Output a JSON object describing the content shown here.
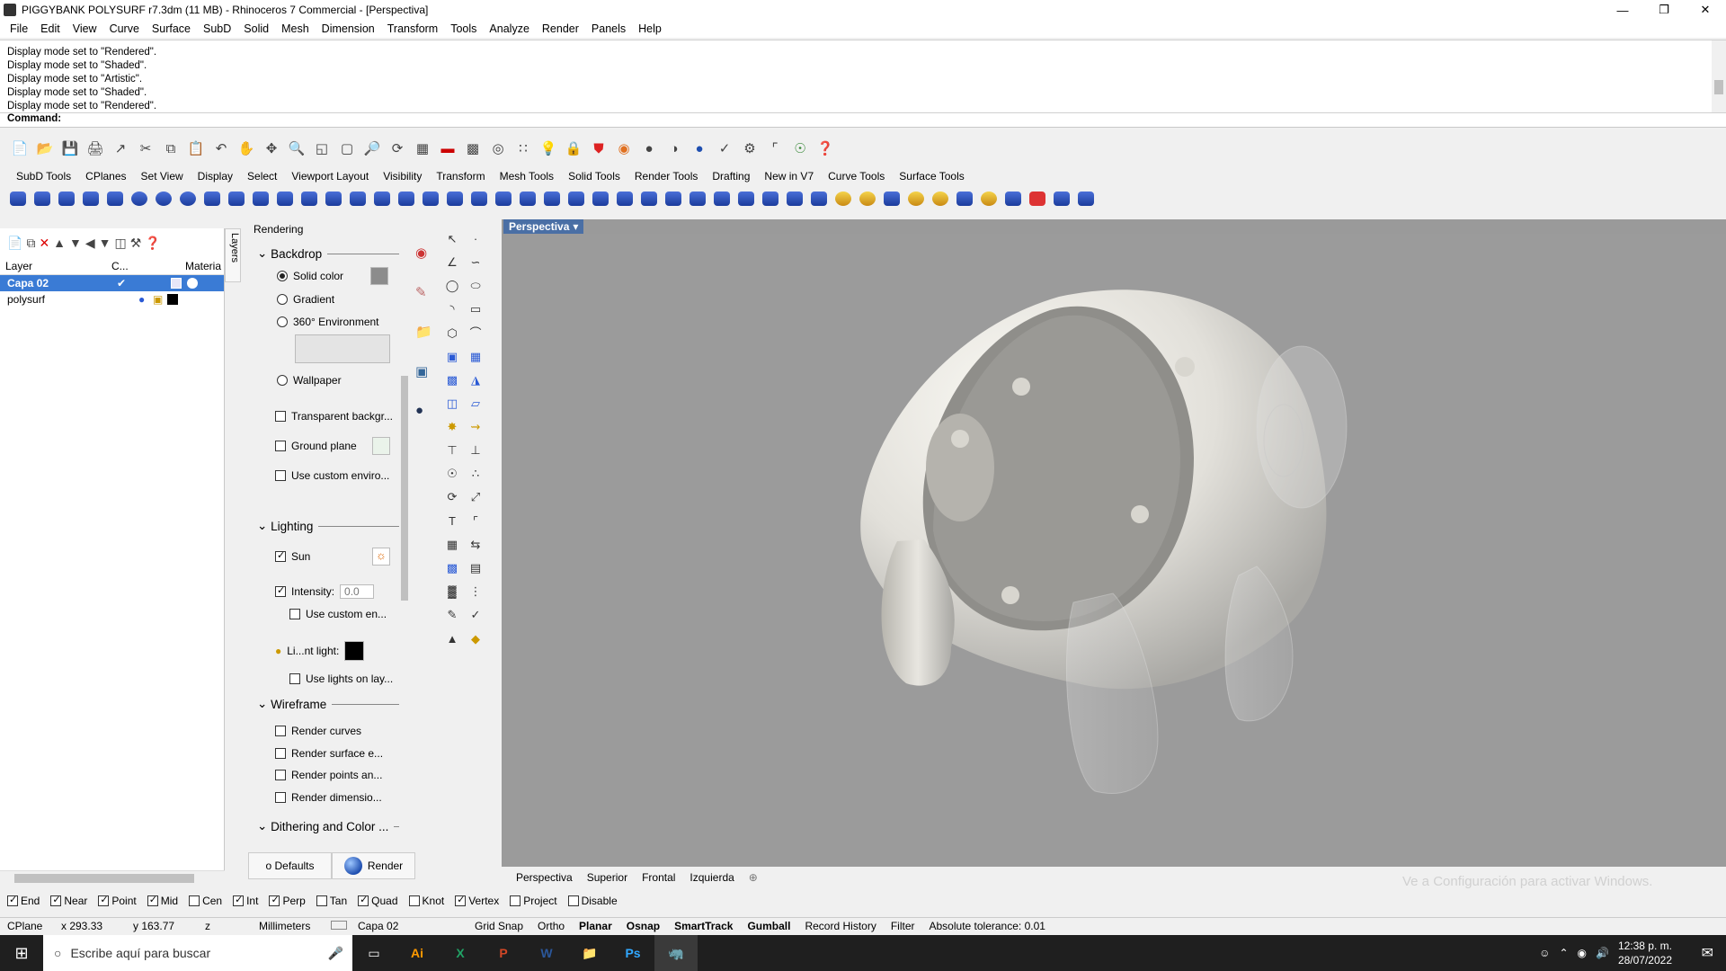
{
  "window": {
    "title": "PIGGYBANK POLYSURF r7.3dm (11 MB) - Rhinoceros 7 Commercial - [Perspectiva]",
    "minimize": "—",
    "restore": "❐",
    "close": "✕"
  },
  "menu": [
    "File",
    "Edit",
    "View",
    "Curve",
    "Surface",
    "SubD",
    "Solid",
    "Mesh",
    "Dimension",
    "Transform",
    "Tools",
    "Analyze",
    "Render",
    "Panels",
    "Help"
  ],
  "history": [
    "Display mode set to \"Rendered\".",
    "Display mode set to \"Shaded\".",
    "Display mode set to \"Artistic\".",
    "Display mode set to \"Shaded\".",
    "Display mode set to \"Rendered\"."
  ],
  "command": {
    "label": "Command:"
  },
  "toolbar_tabs": [
    "SubD Tools",
    "CPlanes",
    "Set View",
    "Display",
    "Select",
    "Viewport Layout",
    "Visibility",
    "Transform",
    "Mesh Tools",
    "Solid Tools",
    "Render Tools",
    "Drafting",
    "New in V7",
    "Curve Tools",
    "Surface Tools"
  ],
  "layers": {
    "tab": "Layers",
    "columns": {
      "layer": "Layer",
      "c": "C...",
      "material": "Materia"
    },
    "rows": [
      {
        "name": "Capa 02",
        "current": "✔"
      },
      {
        "name": "polysurf",
        "current": ""
      }
    ]
  },
  "rendering": {
    "title": "Rendering",
    "backdrop": "Backdrop",
    "solid_color": "Solid color",
    "gradient": "Gradient",
    "env360": "360° Environment",
    "wallpaper": "Wallpaper",
    "transparent": "Transparent backgr...",
    "ground_plane": "Ground plane",
    "custom_env": "Use custom enviro...",
    "lighting": "Lighting",
    "sun": "Sun",
    "intensity_label": "Intensity:",
    "intensity_value": "0.0",
    "use_custom_en": "Use custom en...",
    "light_label": "Li...nt light:",
    "lights_on_layer": "Use lights on lay...",
    "wireframe": "Wireframe",
    "render_curves": "Render curves",
    "render_surface": "Render surface e...",
    "render_points": "Render points an...",
    "render_dims": "Render dimensio...",
    "dithering": "Dithering and Color ...",
    "defaults_btn": "o Defaults",
    "render_btn": "Render"
  },
  "viewport": {
    "title": "Perspectiva",
    "tabs": [
      "Perspectiva",
      "Superior",
      "Frontal",
      "Izquierda"
    ],
    "watermark": "Ve a Configuración para activar Windows."
  },
  "osnap": [
    {
      "label": "End",
      "on": true
    },
    {
      "label": "Near",
      "on": true
    },
    {
      "label": "Point",
      "on": true
    },
    {
      "label": "Mid",
      "on": true
    },
    {
      "label": "Cen",
      "on": false
    },
    {
      "label": "Int",
      "on": true
    },
    {
      "label": "Perp",
      "on": true
    },
    {
      "label": "Tan",
      "on": false
    },
    {
      "label": "Quad",
      "on": true
    },
    {
      "label": "Knot",
      "on": false
    },
    {
      "label": "Vertex",
      "on": true
    },
    {
      "label": "Project",
      "on": false
    },
    {
      "label": "Disable",
      "on": false
    }
  ],
  "status": {
    "cplane": "CPlane",
    "x": "x 293.33",
    "y": "y 163.77",
    "z": "z",
    "units": "Millimeters",
    "layer": "Capa 02",
    "grid_snap": "Grid Snap",
    "ortho": "Ortho",
    "planar": "Planar",
    "osnap": "Osnap",
    "smarttrack": "SmartTrack",
    "gumball": "Gumball",
    "record": "Record History",
    "filter": "Filter",
    "tolerance": "Absolute tolerance: 0.01"
  },
  "taskbar": {
    "search_placeholder": "Escribe aquí para buscar",
    "time": "12:38 p. m.",
    "date": "28/07/2022",
    "apps": [
      "Ai",
      "X",
      "P",
      "W",
      "📁",
      "Ps",
      "🦏"
    ]
  }
}
